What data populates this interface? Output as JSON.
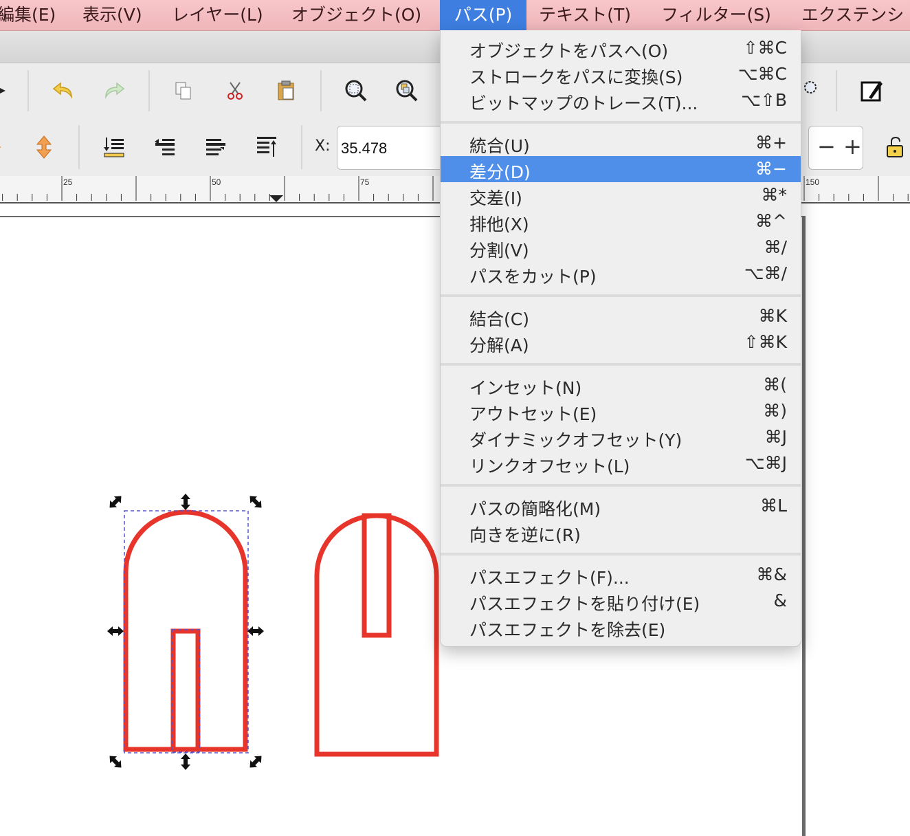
{
  "menubar": {
    "items": [
      "編集(E)",
      "表示(V)",
      "レイヤー(L)",
      "オブジェクト(O)",
      "パス(P)",
      "テキスト(T)",
      "フィルター(S)",
      "エクステンシ"
    ],
    "active_index": 4
  },
  "toolbar": {
    "x_label": "X:",
    "x_value": "35.478",
    "spin_minus": "−",
    "spin_plus": "+"
  },
  "ruler": {
    "labels": [
      "25",
      "50",
      "75",
      "150"
    ]
  },
  "path_menu": {
    "groups": [
      [
        {
          "label": "オブジェクトをパスへ(O)",
          "shortcut": "⇧⌘C"
        },
        {
          "label": "ストロークをパスに変換(S)",
          "shortcut": "⌥⌘C"
        },
        {
          "label": "ビットマップのトレース(T)...",
          "shortcut": "⌥⇧B"
        }
      ],
      [
        {
          "label": "統合(U)",
          "shortcut": "⌘+"
        },
        {
          "label": "差分(D)",
          "shortcut": "⌘−",
          "highlighted": true
        },
        {
          "label": "交差(I)",
          "shortcut": "⌘*"
        },
        {
          "label": "排他(X)",
          "shortcut": "⌘^"
        },
        {
          "label": "分割(V)",
          "shortcut": "⌘/"
        },
        {
          "label": "パスをカット(P)",
          "shortcut": "⌥⌘/"
        }
      ],
      [
        {
          "label": "結合(C)",
          "shortcut": "⌘K"
        },
        {
          "label": "分解(A)",
          "shortcut": "⇧⌘K"
        }
      ],
      [
        {
          "label": "インセット(N)",
          "shortcut": "⌘("
        },
        {
          "label": "アウトセット(E)",
          "shortcut": "⌘)"
        },
        {
          "label": "ダイナミックオフセット(Y)",
          "shortcut": "⌘J"
        },
        {
          "label": "リンクオフセット(L)",
          "shortcut": "⌥⌘J"
        }
      ],
      [
        {
          "label": "パスの簡略化(M)",
          "shortcut": "⌘L"
        },
        {
          "label": "向きを逆に(R)",
          "shortcut": ""
        }
      ],
      [
        {
          "label": "パスエフェクト(F)...",
          "shortcut": "⌘&"
        },
        {
          "label": "パスエフェクトを貼り付け(E)",
          "shortcut": "&"
        },
        {
          "label": "パスエフェクトを除去(E)",
          "shortcut": ""
        }
      ]
    ]
  },
  "colors": {
    "menubar_bg": "#f4bfc3",
    "menu_highlight": "#4f8fea",
    "shape_stroke": "#e8352b",
    "selection_dash": "#5555cc"
  }
}
